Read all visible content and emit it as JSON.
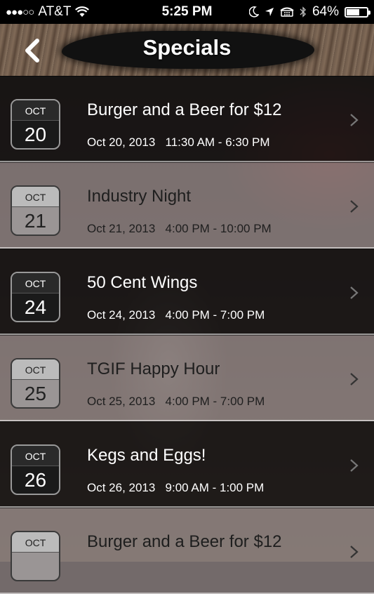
{
  "status_bar": {
    "carrier": "AT&T",
    "time": "5:25 PM",
    "battery": "64%",
    "battery_level": 0.64,
    "icons": [
      "signal-dots-icon",
      "wifi-icon",
      "moon-icon",
      "location-arrow-icon",
      "tty-icon",
      "bluetooth-icon",
      "battery-icon"
    ]
  },
  "nav": {
    "title": "Specials",
    "back_icon": "chevron-left-icon"
  },
  "specials": [
    {
      "month": "OCT",
      "day": "20",
      "title": "Burger and a Beer for $12",
      "date": "Oct 20, 2013",
      "time": "11:30 AM - 6:30 PM",
      "style": "dark"
    },
    {
      "month": "OCT",
      "day": "21",
      "title": "Industry Night",
      "date": "Oct 21, 2013",
      "time": "4:00 PM - 10:00 PM",
      "style": "light"
    },
    {
      "month": "OCT",
      "day": "24",
      "title": "50 Cent Wings",
      "date": "Oct 24, 2013",
      "time": "4:00 PM - 7:00 PM",
      "style": "dark"
    },
    {
      "month": "OCT",
      "day": "25",
      "title": "TGIF Happy Hour",
      "date": "Oct 25, 2013",
      "time": "4:00 PM - 7:00 PM",
      "style": "light"
    },
    {
      "month": "OCT",
      "day": "26",
      "title": "Kegs and Eggs!",
      "date": "Oct 26, 2013",
      "time": "9:00 AM - 1:00 PM",
      "style": "dark"
    },
    {
      "month": "OCT",
      "day": "",
      "title": "Burger and a Beer for $12",
      "date": "",
      "time": "",
      "style": "light"
    }
  ]
}
